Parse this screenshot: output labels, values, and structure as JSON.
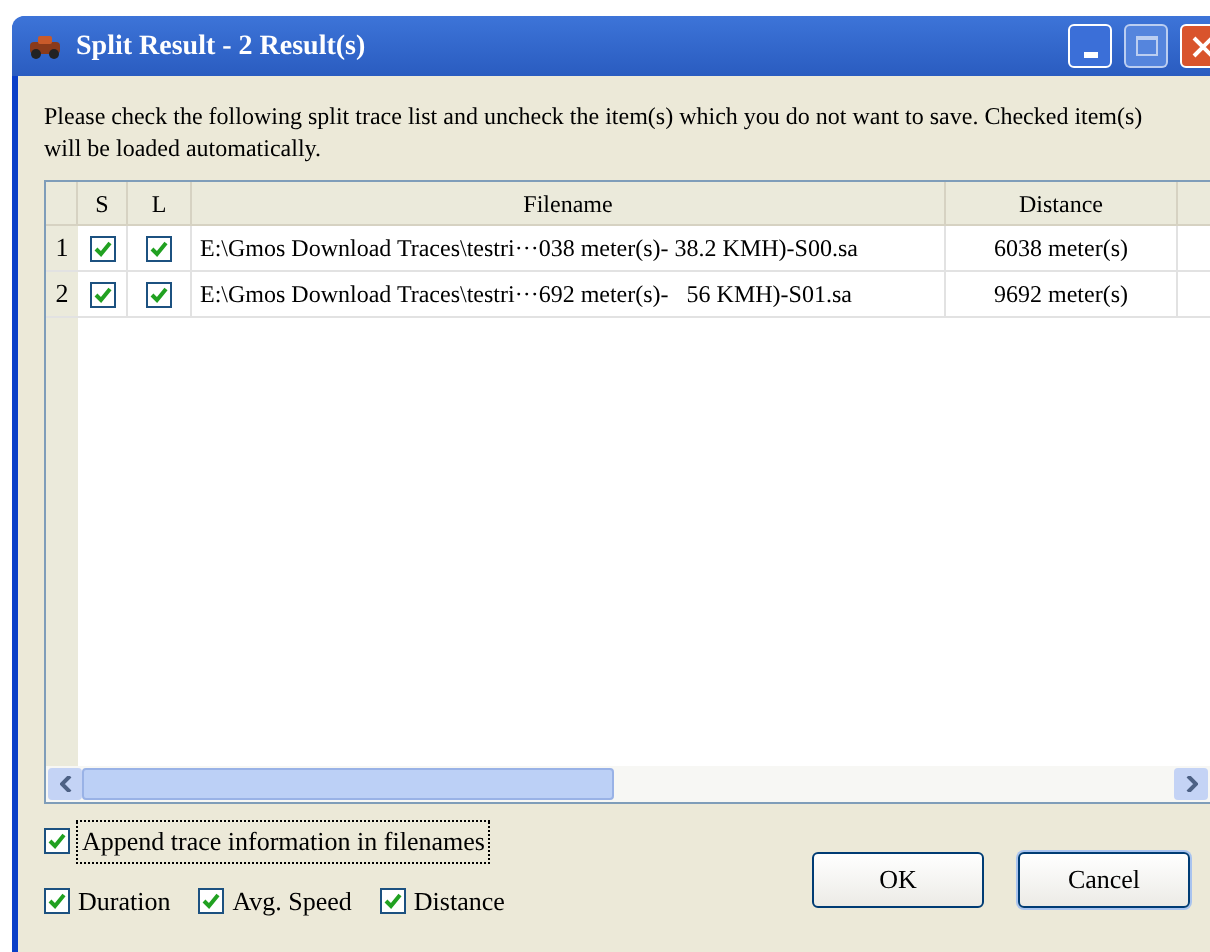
{
  "window": {
    "title": "Split Result - 2 Result(s)"
  },
  "message": "Please check the following split trace list and uncheck the item(s) which you do not want to save. Checked item(s) will be loaded automatically.",
  "table": {
    "columns": [
      "S",
      "L",
      "Filename",
      "Distance"
    ],
    "rows": [
      {
        "number": "1",
        "save": true,
        "load": true,
        "filename": "E:\\Gmos Download Traces\\testri···038 meter(s)- 38.2 KMH)-S00.sa",
        "distance": "6038 meter(s)"
      },
      {
        "number": "2",
        "save": true,
        "load": true,
        "filename": "E:\\Gmos Download Traces\\testri···692 meter(s)-   56 KMH)-S01.sa",
        "distance": "9692 meter(s)"
      }
    ]
  },
  "append_option": {
    "label": "Append trace information in filenames",
    "checked": true
  },
  "info_options": [
    {
      "label": "Duration",
      "checked": true
    },
    {
      "label": "Avg. Speed",
      "checked": true
    },
    {
      "label": "Distance",
      "checked": true
    }
  ],
  "buttons": [
    "OK",
    "Cancel"
  ]
}
